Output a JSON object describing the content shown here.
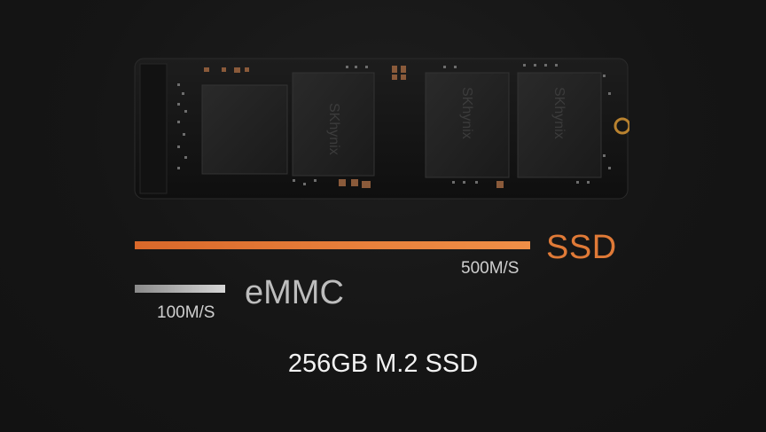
{
  "photo": {
    "chip_brand": "SKhynix"
  },
  "comparison": {
    "ssd": {
      "label": "SSD",
      "speed": "500M/S",
      "relative_speed": 500,
      "color": "#e07a37"
    },
    "emmc": {
      "label": "eMMC",
      "speed": "100M/S",
      "relative_speed": 100,
      "color": "#bdbdbd"
    }
  },
  "caption": "256GB M.2 SSD"
}
